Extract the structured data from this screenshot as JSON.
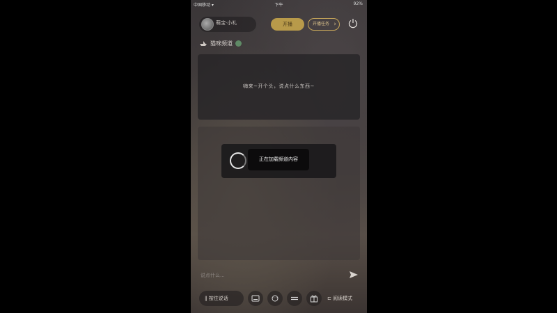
{
  "status_bar": {
    "carrier": "中国移动 ▾",
    "time": "下午",
    "battery": "92%"
  },
  "header": {
    "profile_name": "萌宝·小礼",
    "gold_button_label": "开播",
    "outline_button_label": "开播任务",
    "outline_button_arrow": "›"
  },
  "section": {
    "title": "猫咪频道"
  },
  "prompt_card": {
    "text": "嗨来~开个头，说点什么东西~"
  },
  "toast": {
    "label": "正在加载频道内容"
  },
  "composer": {
    "placeholder": "说点什么..."
  },
  "bottom_bar": {
    "voice_label": "按住说话",
    "read_label": "阅读模式",
    "icons": [
      "keyboard-icon",
      "emoji-icon",
      "menu-icon",
      "gift-icon"
    ]
  },
  "colors": {
    "accent_gold": "#b89a4a",
    "outline_gold": "#c9a85a",
    "screen_bg": "#000000"
  }
}
